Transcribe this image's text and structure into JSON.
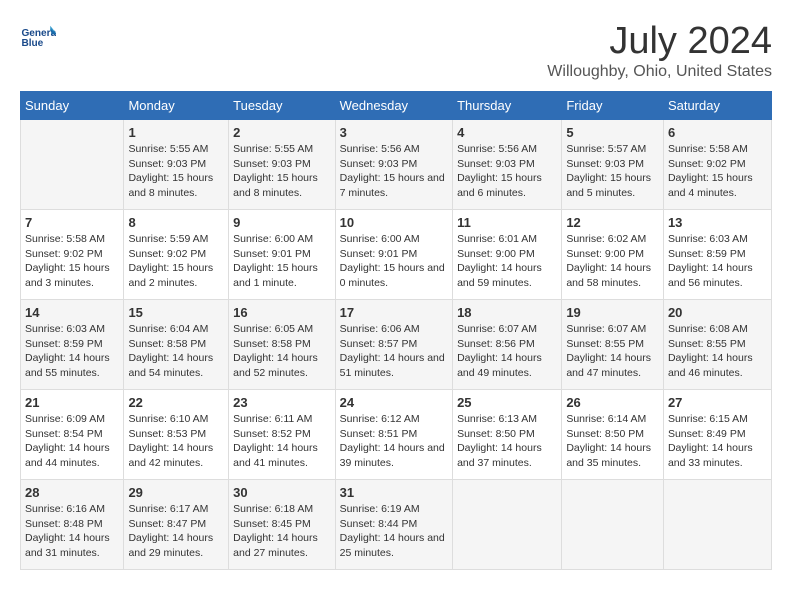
{
  "header": {
    "logo_line1": "General",
    "logo_line2": "Blue",
    "main_title": "July 2024",
    "subtitle": "Willoughby, Ohio, United States"
  },
  "days_of_week": [
    "Sunday",
    "Monday",
    "Tuesday",
    "Wednesday",
    "Thursday",
    "Friday",
    "Saturday"
  ],
  "weeks": [
    [
      {
        "day": "",
        "sunrise": "",
        "sunset": "",
        "daylight": ""
      },
      {
        "day": "1",
        "sunrise": "Sunrise: 5:55 AM",
        "sunset": "Sunset: 9:03 PM",
        "daylight": "Daylight: 15 hours and 8 minutes."
      },
      {
        "day": "2",
        "sunrise": "Sunrise: 5:55 AM",
        "sunset": "Sunset: 9:03 PM",
        "daylight": "Daylight: 15 hours and 8 minutes."
      },
      {
        "day": "3",
        "sunrise": "Sunrise: 5:56 AM",
        "sunset": "Sunset: 9:03 PM",
        "daylight": "Daylight: 15 hours and 7 minutes."
      },
      {
        "day": "4",
        "sunrise": "Sunrise: 5:56 AM",
        "sunset": "Sunset: 9:03 PM",
        "daylight": "Daylight: 15 hours and 6 minutes."
      },
      {
        "day": "5",
        "sunrise": "Sunrise: 5:57 AM",
        "sunset": "Sunset: 9:03 PM",
        "daylight": "Daylight: 15 hours and 5 minutes."
      },
      {
        "day": "6",
        "sunrise": "Sunrise: 5:58 AM",
        "sunset": "Sunset: 9:02 PM",
        "daylight": "Daylight: 15 hours and 4 minutes."
      }
    ],
    [
      {
        "day": "7",
        "sunrise": "Sunrise: 5:58 AM",
        "sunset": "Sunset: 9:02 PM",
        "daylight": "Daylight: 15 hours and 3 minutes."
      },
      {
        "day": "8",
        "sunrise": "Sunrise: 5:59 AM",
        "sunset": "Sunset: 9:02 PM",
        "daylight": "Daylight: 15 hours and 2 minutes."
      },
      {
        "day": "9",
        "sunrise": "Sunrise: 6:00 AM",
        "sunset": "Sunset: 9:01 PM",
        "daylight": "Daylight: 15 hours and 1 minute."
      },
      {
        "day": "10",
        "sunrise": "Sunrise: 6:00 AM",
        "sunset": "Sunset: 9:01 PM",
        "daylight": "Daylight: 15 hours and 0 minutes."
      },
      {
        "day": "11",
        "sunrise": "Sunrise: 6:01 AM",
        "sunset": "Sunset: 9:00 PM",
        "daylight": "Daylight: 14 hours and 59 minutes."
      },
      {
        "day": "12",
        "sunrise": "Sunrise: 6:02 AM",
        "sunset": "Sunset: 9:00 PM",
        "daylight": "Daylight: 14 hours and 58 minutes."
      },
      {
        "day": "13",
        "sunrise": "Sunrise: 6:03 AM",
        "sunset": "Sunset: 8:59 PM",
        "daylight": "Daylight: 14 hours and 56 minutes."
      }
    ],
    [
      {
        "day": "14",
        "sunrise": "Sunrise: 6:03 AM",
        "sunset": "Sunset: 8:59 PM",
        "daylight": "Daylight: 14 hours and 55 minutes."
      },
      {
        "day": "15",
        "sunrise": "Sunrise: 6:04 AM",
        "sunset": "Sunset: 8:58 PM",
        "daylight": "Daylight: 14 hours and 54 minutes."
      },
      {
        "day": "16",
        "sunrise": "Sunrise: 6:05 AM",
        "sunset": "Sunset: 8:58 PM",
        "daylight": "Daylight: 14 hours and 52 minutes."
      },
      {
        "day": "17",
        "sunrise": "Sunrise: 6:06 AM",
        "sunset": "Sunset: 8:57 PM",
        "daylight": "Daylight: 14 hours and 51 minutes."
      },
      {
        "day": "18",
        "sunrise": "Sunrise: 6:07 AM",
        "sunset": "Sunset: 8:56 PM",
        "daylight": "Daylight: 14 hours and 49 minutes."
      },
      {
        "day": "19",
        "sunrise": "Sunrise: 6:07 AM",
        "sunset": "Sunset: 8:55 PM",
        "daylight": "Daylight: 14 hours and 47 minutes."
      },
      {
        "day": "20",
        "sunrise": "Sunrise: 6:08 AM",
        "sunset": "Sunset: 8:55 PM",
        "daylight": "Daylight: 14 hours and 46 minutes."
      }
    ],
    [
      {
        "day": "21",
        "sunrise": "Sunrise: 6:09 AM",
        "sunset": "Sunset: 8:54 PM",
        "daylight": "Daylight: 14 hours and 44 minutes."
      },
      {
        "day": "22",
        "sunrise": "Sunrise: 6:10 AM",
        "sunset": "Sunset: 8:53 PM",
        "daylight": "Daylight: 14 hours and 42 minutes."
      },
      {
        "day": "23",
        "sunrise": "Sunrise: 6:11 AM",
        "sunset": "Sunset: 8:52 PM",
        "daylight": "Daylight: 14 hours and 41 minutes."
      },
      {
        "day": "24",
        "sunrise": "Sunrise: 6:12 AM",
        "sunset": "Sunset: 8:51 PM",
        "daylight": "Daylight: 14 hours and 39 minutes."
      },
      {
        "day": "25",
        "sunrise": "Sunrise: 6:13 AM",
        "sunset": "Sunset: 8:50 PM",
        "daylight": "Daylight: 14 hours and 37 minutes."
      },
      {
        "day": "26",
        "sunrise": "Sunrise: 6:14 AM",
        "sunset": "Sunset: 8:50 PM",
        "daylight": "Daylight: 14 hours and 35 minutes."
      },
      {
        "day": "27",
        "sunrise": "Sunrise: 6:15 AM",
        "sunset": "Sunset: 8:49 PM",
        "daylight": "Daylight: 14 hours and 33 minutes."
      }
    ],
    [
      {
        "day": "28",
        "sunrise": "Sunrise: 6:16 AM",
        "sunset": "Sunset: 8:48 PM",
        "daylight": "Daylight: 14 hours and 31 minutes."
      },
      {
        "day": "29",
        "sunrise": "Sunrise: 6:17 AM",
        "sunset": "Sunset: 8:47 PM",
        "daylight": "Daylight: 14 hours and 29 minutes."
      },
      {
        "day": "30",
        "sunrise": "Sunrise: 6:18 AM",
        "sunset": "Sunset: 8:45 PM",
        "daylight": "Daylight: 14 hours and 27 minutes."
      },
      {
        "day": "31",
        "sunrise": "Sunrise: 6:19 AM",
        "sunset": "Sunset: 8:44 PM",
        "daylight": "Daylight: 14 hours and 25 minutes."
      },
      {
        "day": "",
        "sunrise": "",
        "sunset": "",
        "daylight": ""
      },
      {
        "day": "",
        "sunrise": "",
        "sunset": "",
        "daylight": ""
      },
      {
        "day": "",
        "sunrise": "",
        "sunset": "",
        "daylight": ""
      }
    ]
  ]
}
